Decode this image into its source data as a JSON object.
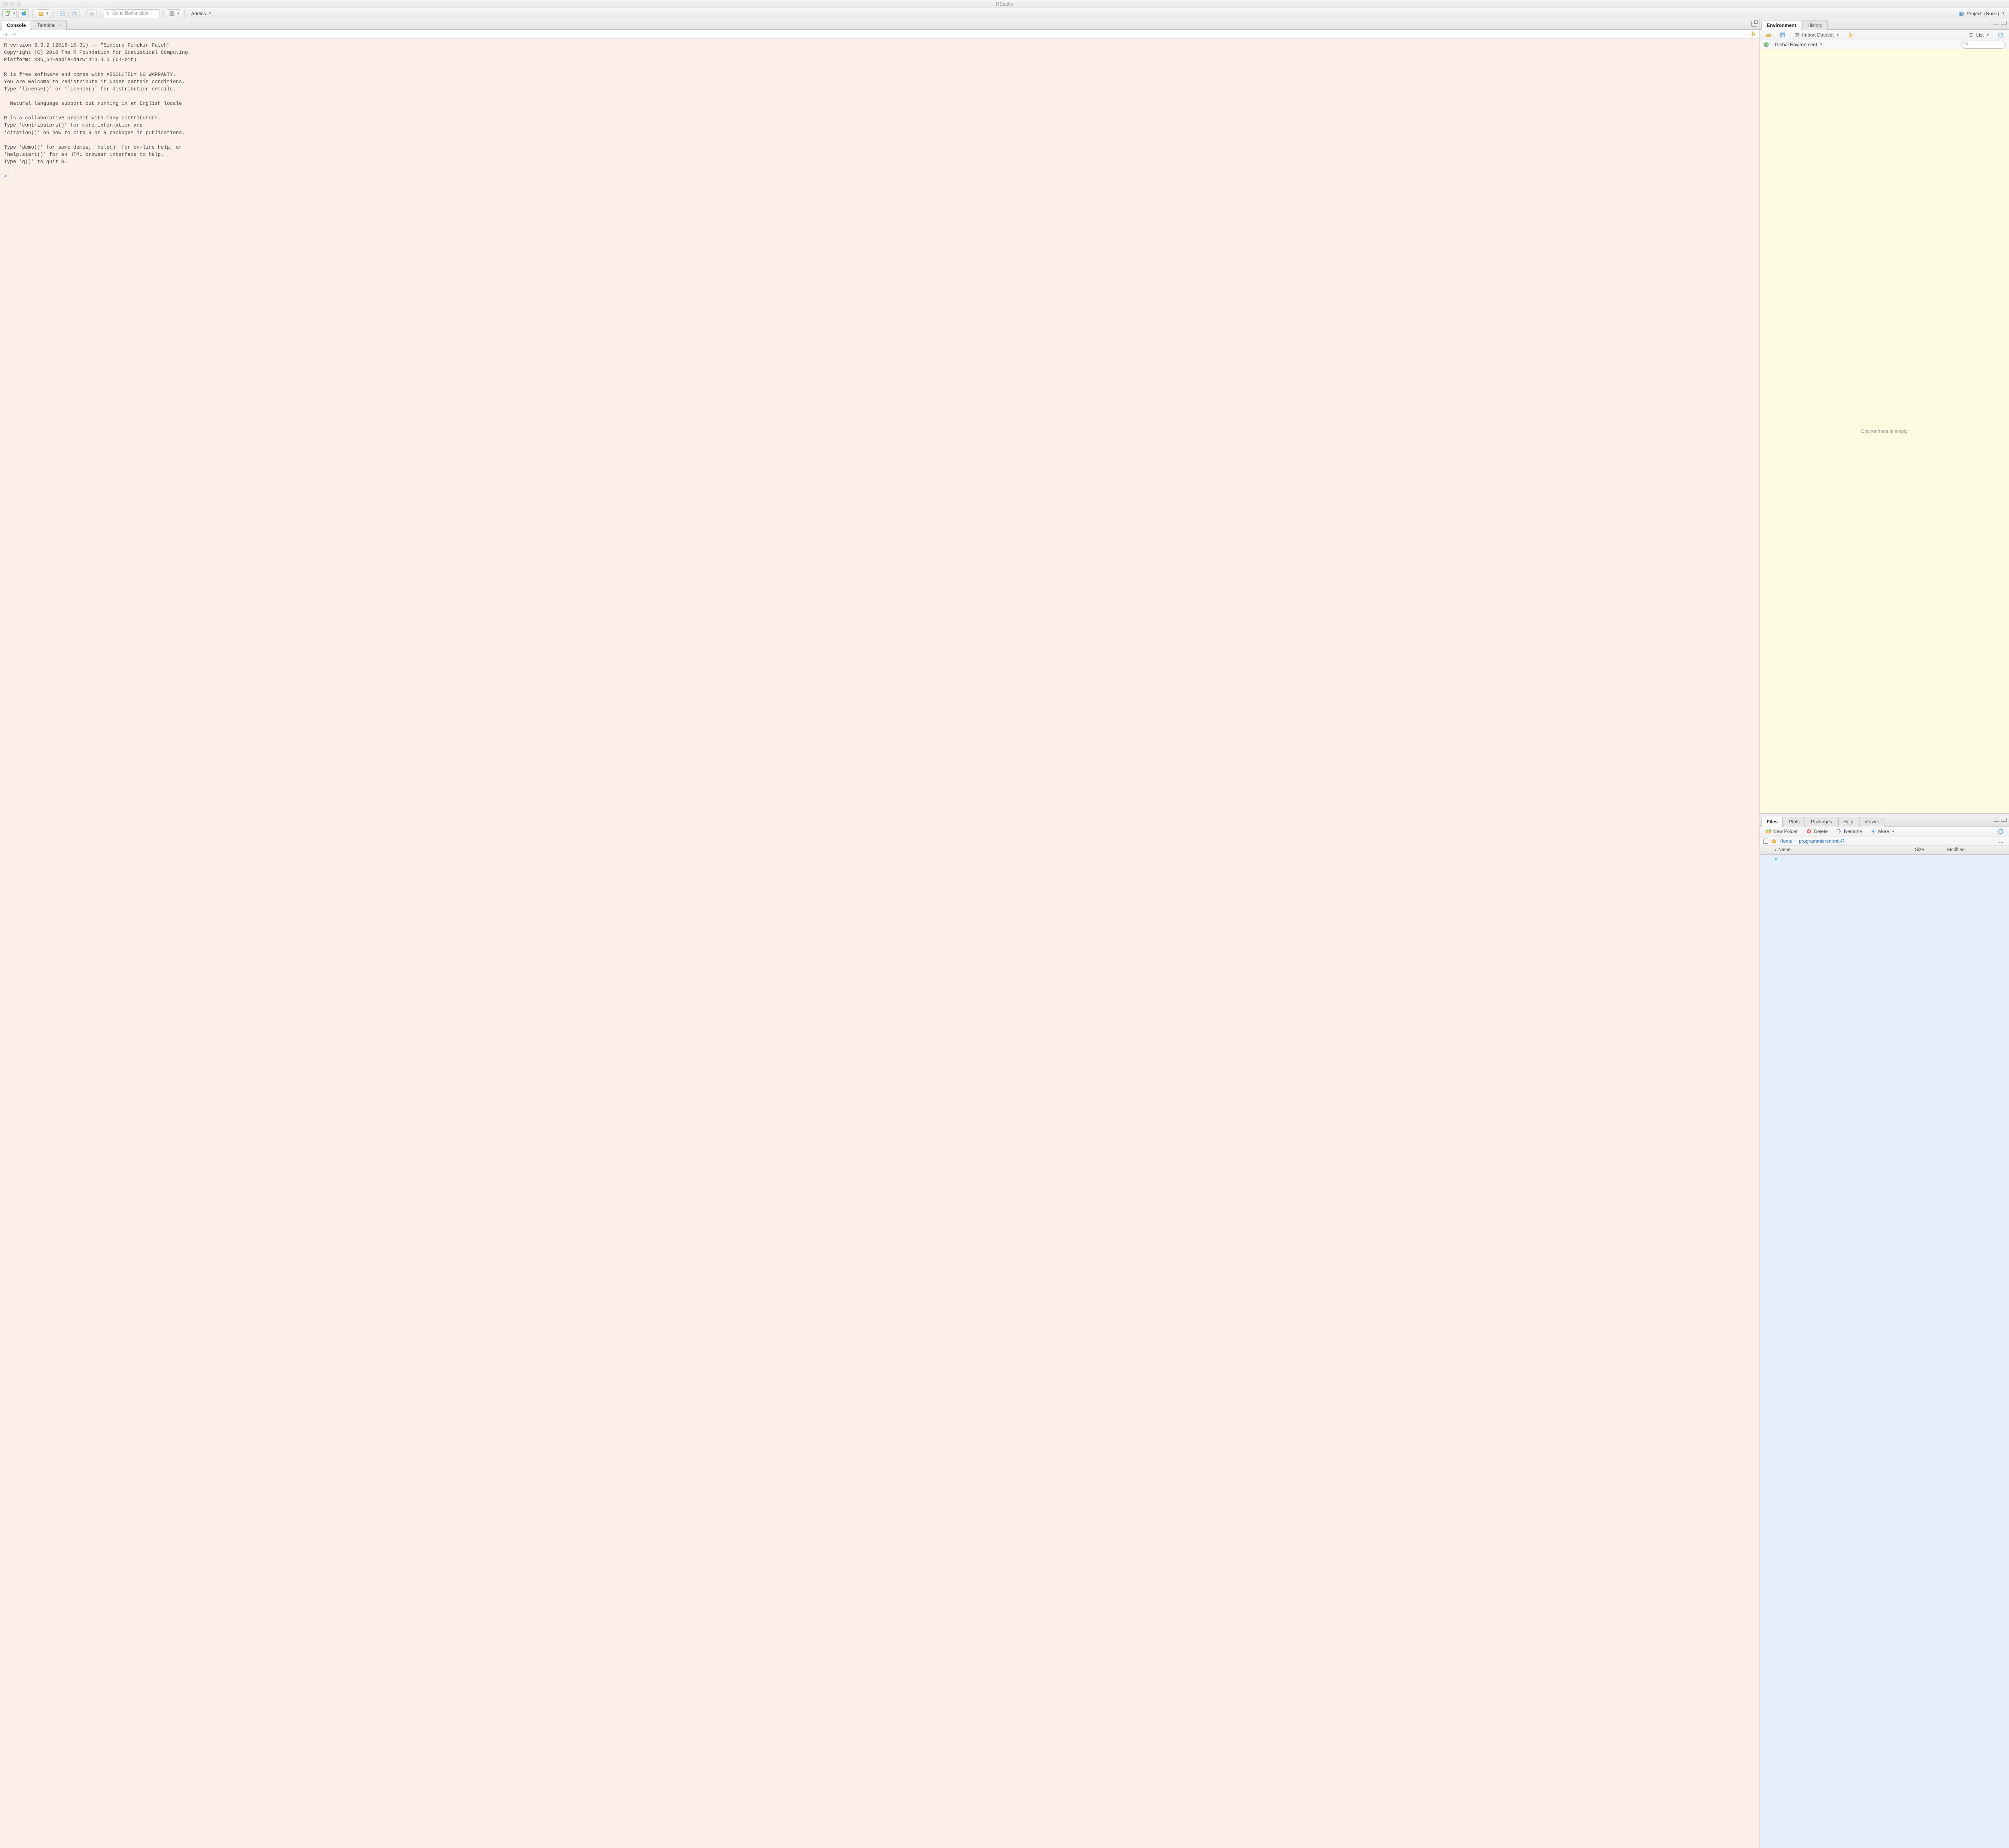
{
  "window": {
    "title": "RStudio"
  },
  "toolbar": {
    "goto_placeholder": "Go to file/function",
    "addins_label": "Addins",
    "project_label": "Project: (None)"
  },
  "left_pane": {
    "tabs": [
      "Console",
      "Terminal"
    ],
    "active_tab": "Console",
    "console": {
      "path": "~/",
      "prompt": ">",
      "startup_text": "R version 3.3.2 (2016-10-31) -- \"Sincere Pumpkin Patch\"\nCopyright (C) 2016 The R Foundation for Statistical Computing\nPlatform: x86_64-apple-darwin13.4.0 (64-bit)\n\nR is free software and comes with ABSOLUTELY NO WARRANTY.\nYou are welcome to redistribute it under certain conditions.\nType 'license()' or 'licence()' for distribution details.\n\n  Natural language support but running in an English locale\n\nR is a collaborative project with many contributors.\nType 'contributors()' for more information and\n'citation()' on how to cite R or R packages in publications.\n\nType 'demo()' for some demos, 'help()' for on-line help, or\n'help.start()' for an HTML browser interface to help.\nType 'q()' to quit R."
    }
  },
  "top_right_pane": {
    "tabs": [
      "Environment",
      "History"
    ],
    "active_tab": "Environment",
    "toolbar": {
      "import_label": "Import Dataset",
      "view_label": "List"
    },
    "scope_label": "Global Environment",
    "empty_text": "Environment is empty"
  },
  "bottom_right_pane": {
    "tabs": [
      "Files",
      "Plots",
      "Packages",
      "Help",
      "Viewer"
    ],
    "active_tab": "Files",
    "toolbar": {
      "new_folder": "New Folder",
      "delete": "Delete",
      "rename": "Rename",
      "more": "More"
    },
    "breadcrumb": [
      "Home",
      "programmieren-mit-R"
    ],
    "columns": {
      "name": "Name",
      "size": "Size",
      "modified": "Modified"
    },
    "up_row": ".."
  }
}
